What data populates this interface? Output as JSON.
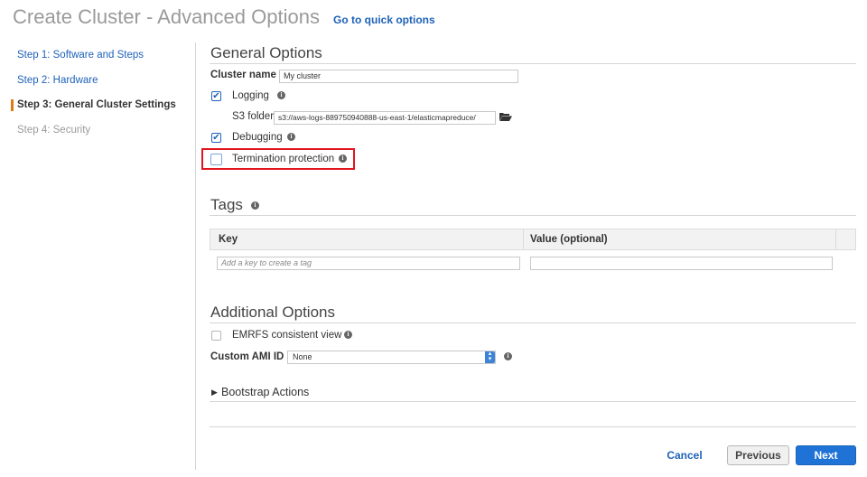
{
  "header": {
    "title": "Create Cluster - Advanced Options",
    "quick_options_link": "Go to quick options"
  },
  "sidebar": {
    "items": [
      {
        "label": "Step 1: Software and Steps",
        "state": "link"
      },
      {
        "label": "Step 2: Hardware",
        "state": "link"
      },
      {
        "label": "Step 3: General Cluster Settings",
        "state": "active"
      },
      {
        "label": "Step 4: Security",
        "state": "disabled"
      }
    ]
  },
  "general": {
    "title": "General Options",
    "cluster_name_label": "Cluster name",
    "cluster_name_value": "My cluster",
    "logging_label": "Logging",
    "logging_checked": true,
    "s3_folder_label": "S3 folder",
    "s3_folder_value": "s3://aws-logs-889750940888-us-east-1/elasticmapreduce/",
    "debugging_label": "Debugging",
    "debugging_checked": true,
    "termination_label": "Termination protection",
    "termination_checked": false
  },
  "tags": {
    "title": "Tags",
    "columns": [
      "Key",
      "Value (optional)"
    ],
    "key_placeholder": "Add a key to create a tag",
    "value_placeholder": ""
  },
  "additional": {
    "title": "Additional Options",
    "emrfs_label": "EMRFS consistent view",
    "emrfs_checked": false,
    "ami_label": "Custom AMI ID",
    "ami_value": "None",
    "bootstrap_label": "Bootstrap Actions"
  },
  "footer": {
    "cancel": "Cancel",
    "previous": "Previous",
    "next": "Next"
  },
  "icons": {
    "info": "info-icon",
    "folder": "folder-open-icon",
    "caret": "caret-right-icon",
    "select_arrows": "select-arrows-icon"
  },
  "colors": {
    "link": "#1e62b8",
    "primary_button": "#1f73d6",
    "active_marker": "#e47911",
    "highlight": "#e0151f"
  }
}
